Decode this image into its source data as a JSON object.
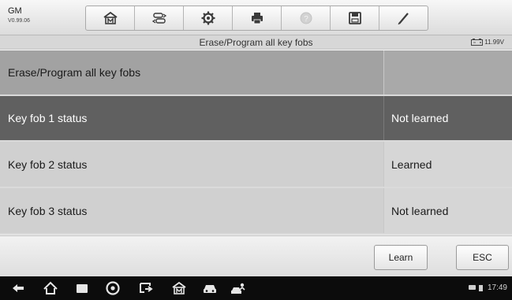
{
  "header": {
    "brand": "GM",
    "version": "V0.99.06",
    "tools": [
      {
        "icon": "home-icon",
        "enabled": true
      },
      {
        "icon": "vehicle-swap-icon",
        "enabled": true
      },
      {
        "icon": "gear-icon",
        "enabled": true
      },
      {
        "icon": "printer-icon",
        "enabled": true
      },
      {
        "icon": "help-icon",
        "enabled": false
      },
      {
        "icon": "save-icon",
        "enabled": true
      },
      {
        "icon": "pen-icon",
        "enabled": true
      }
    ]
  },
  "titlebar": {
    "title": "Erase/Program all key fobs",
    "battery_voltage": "11.99V"
  },
  "table": {
    "header_row": {
      "label": "Erase/Program all key fobs",
      "value": ""
    },
    "rows": [
      {
        "label": "Key fob 1 status",
        "value": "Not learned",
        "selected": true
      },
      {
        "label": "Key fob 2 status",
        "value": "Learned",
        "selected": false
      },
      {
        "label": "Key fob 3 status",
        "value": "Not learned",
        "selected": false
      }
    ]
  },
  "actions": {
    "learn_label": "Learn",
    "esc_label": "ESC"
  },
  "navbar": {
    "items": [
      "back-icon",
      "home-icon",
      "recent-apps-icon",
      "browser-icon",
      "screen-share-icon",
      "car-home-icon",
      "car-icon",
      "vehicle-diagnostic-icon"
    ],
    "time": "17:49"
  },
  "colors": {
    "selected_row": "#606060",
    "header_row": "#a2a2a2",
    "plain_row": "#d0d0d0",
    "navbar": "#0c0c0c"
  }
}
